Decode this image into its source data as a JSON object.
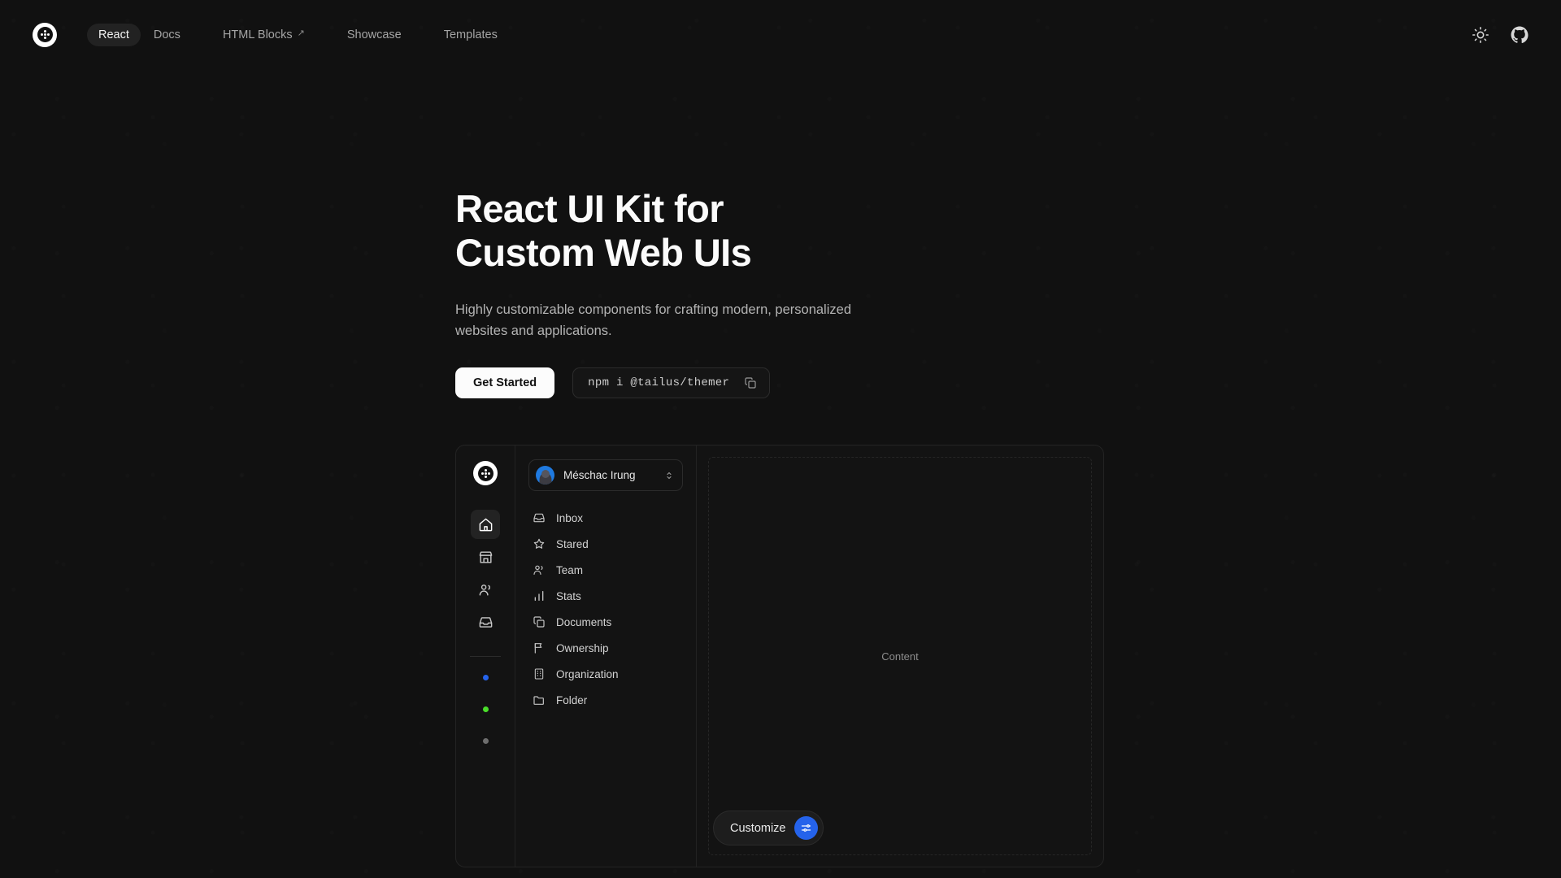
{
  "brand": {
    "logo_icon": "tailus-dots-logo"
  },
  "nav": {
    "links": [
      {
        "label": "React",
        "icon": null,
        "active": true
      },
      {
        "label": "Docs",
        "icon": null,
        "active": false
      },
      {
        "label": "HTML Blocks",
        "icon": "external-link-arrow-icon",
        "active": false
      },
      {
        "label": "Showcase",
        "icon": null,
        "active": false
      },
      {
        "label": "Templates",
        "icon": null,
        "active": false
      }
    ],
    "external_arrow": "↗",
    "right_icons": [
      {
        "name": "sun-icon",
        "label": "Toggle theme"
      },
      {
        "name": "github-icon",
        "label": "GitHub"
      }
    ]
  },
  "hero": {
    "title_line1": "React UI Kit for",
    "title_line2": "Custom Web UIs",
    "description": "Highly customizable components for crafting modern, personalized websites and applications.",
    "cta_label": "Get Started",
    "install_command": "npm i @tailus/themer",
    "copy_icon": "copy-icon"
  },
  "preview": {
    "rail": {
      "logo_icon": "tailus-dots-logo",
      "icons": [
        {
          "name": "home-icon",
          "active": true
        },
        {
          "name": "store-icon",
          "active": false
        },
        {
          "name": "users-icon",
          "active": false
        },
        {
          "name": "inbox-icon",
          "active": false
        }
      ],
      "dots": [
        {
          "name": "status-dot-blue",
          "color": "#2563eb"
        },
        {
          "name": "status-dot-green",
          "color": "#4ade2a"
        },
        {
          "name": "status-dot-gray",
          "color": "#6e6e6e"
        }
      ]
    },
    "user": {
      "name": "Méschac Irung",
      "avatar": "user-avatar",
      "chevron": "chevron-up-down-icon"
    },
    "menu": [
      {
        "label": "Inbox",
        "icon": "inbox-icon"
      },
      {
        "label": "Stared",
        "icon": "star-icon"
      },
      {
        "label": "Team",
        "icon": "users-icon"
      },
      {
        "label": "Stats",
        "icon": "bar-chart-icon"
      },
      {
        "label": "Documents",
        "icon": "documents-copy-icon"
      },
      {
        "label": "Ownership",
        "icon": "flag-icon"
      },
      {
        "label": "Organization",
        "icon": "building-icon"
      },
      {
        "label": "Folder",
        "icon": "folder-icon"
      }
    ],
    "content_placeholder": "Content",
    "customize": {
      "label": "Customize",
      "icon": "sliders-icon",
      "accent": "#2563eb"
    }
  }
}
